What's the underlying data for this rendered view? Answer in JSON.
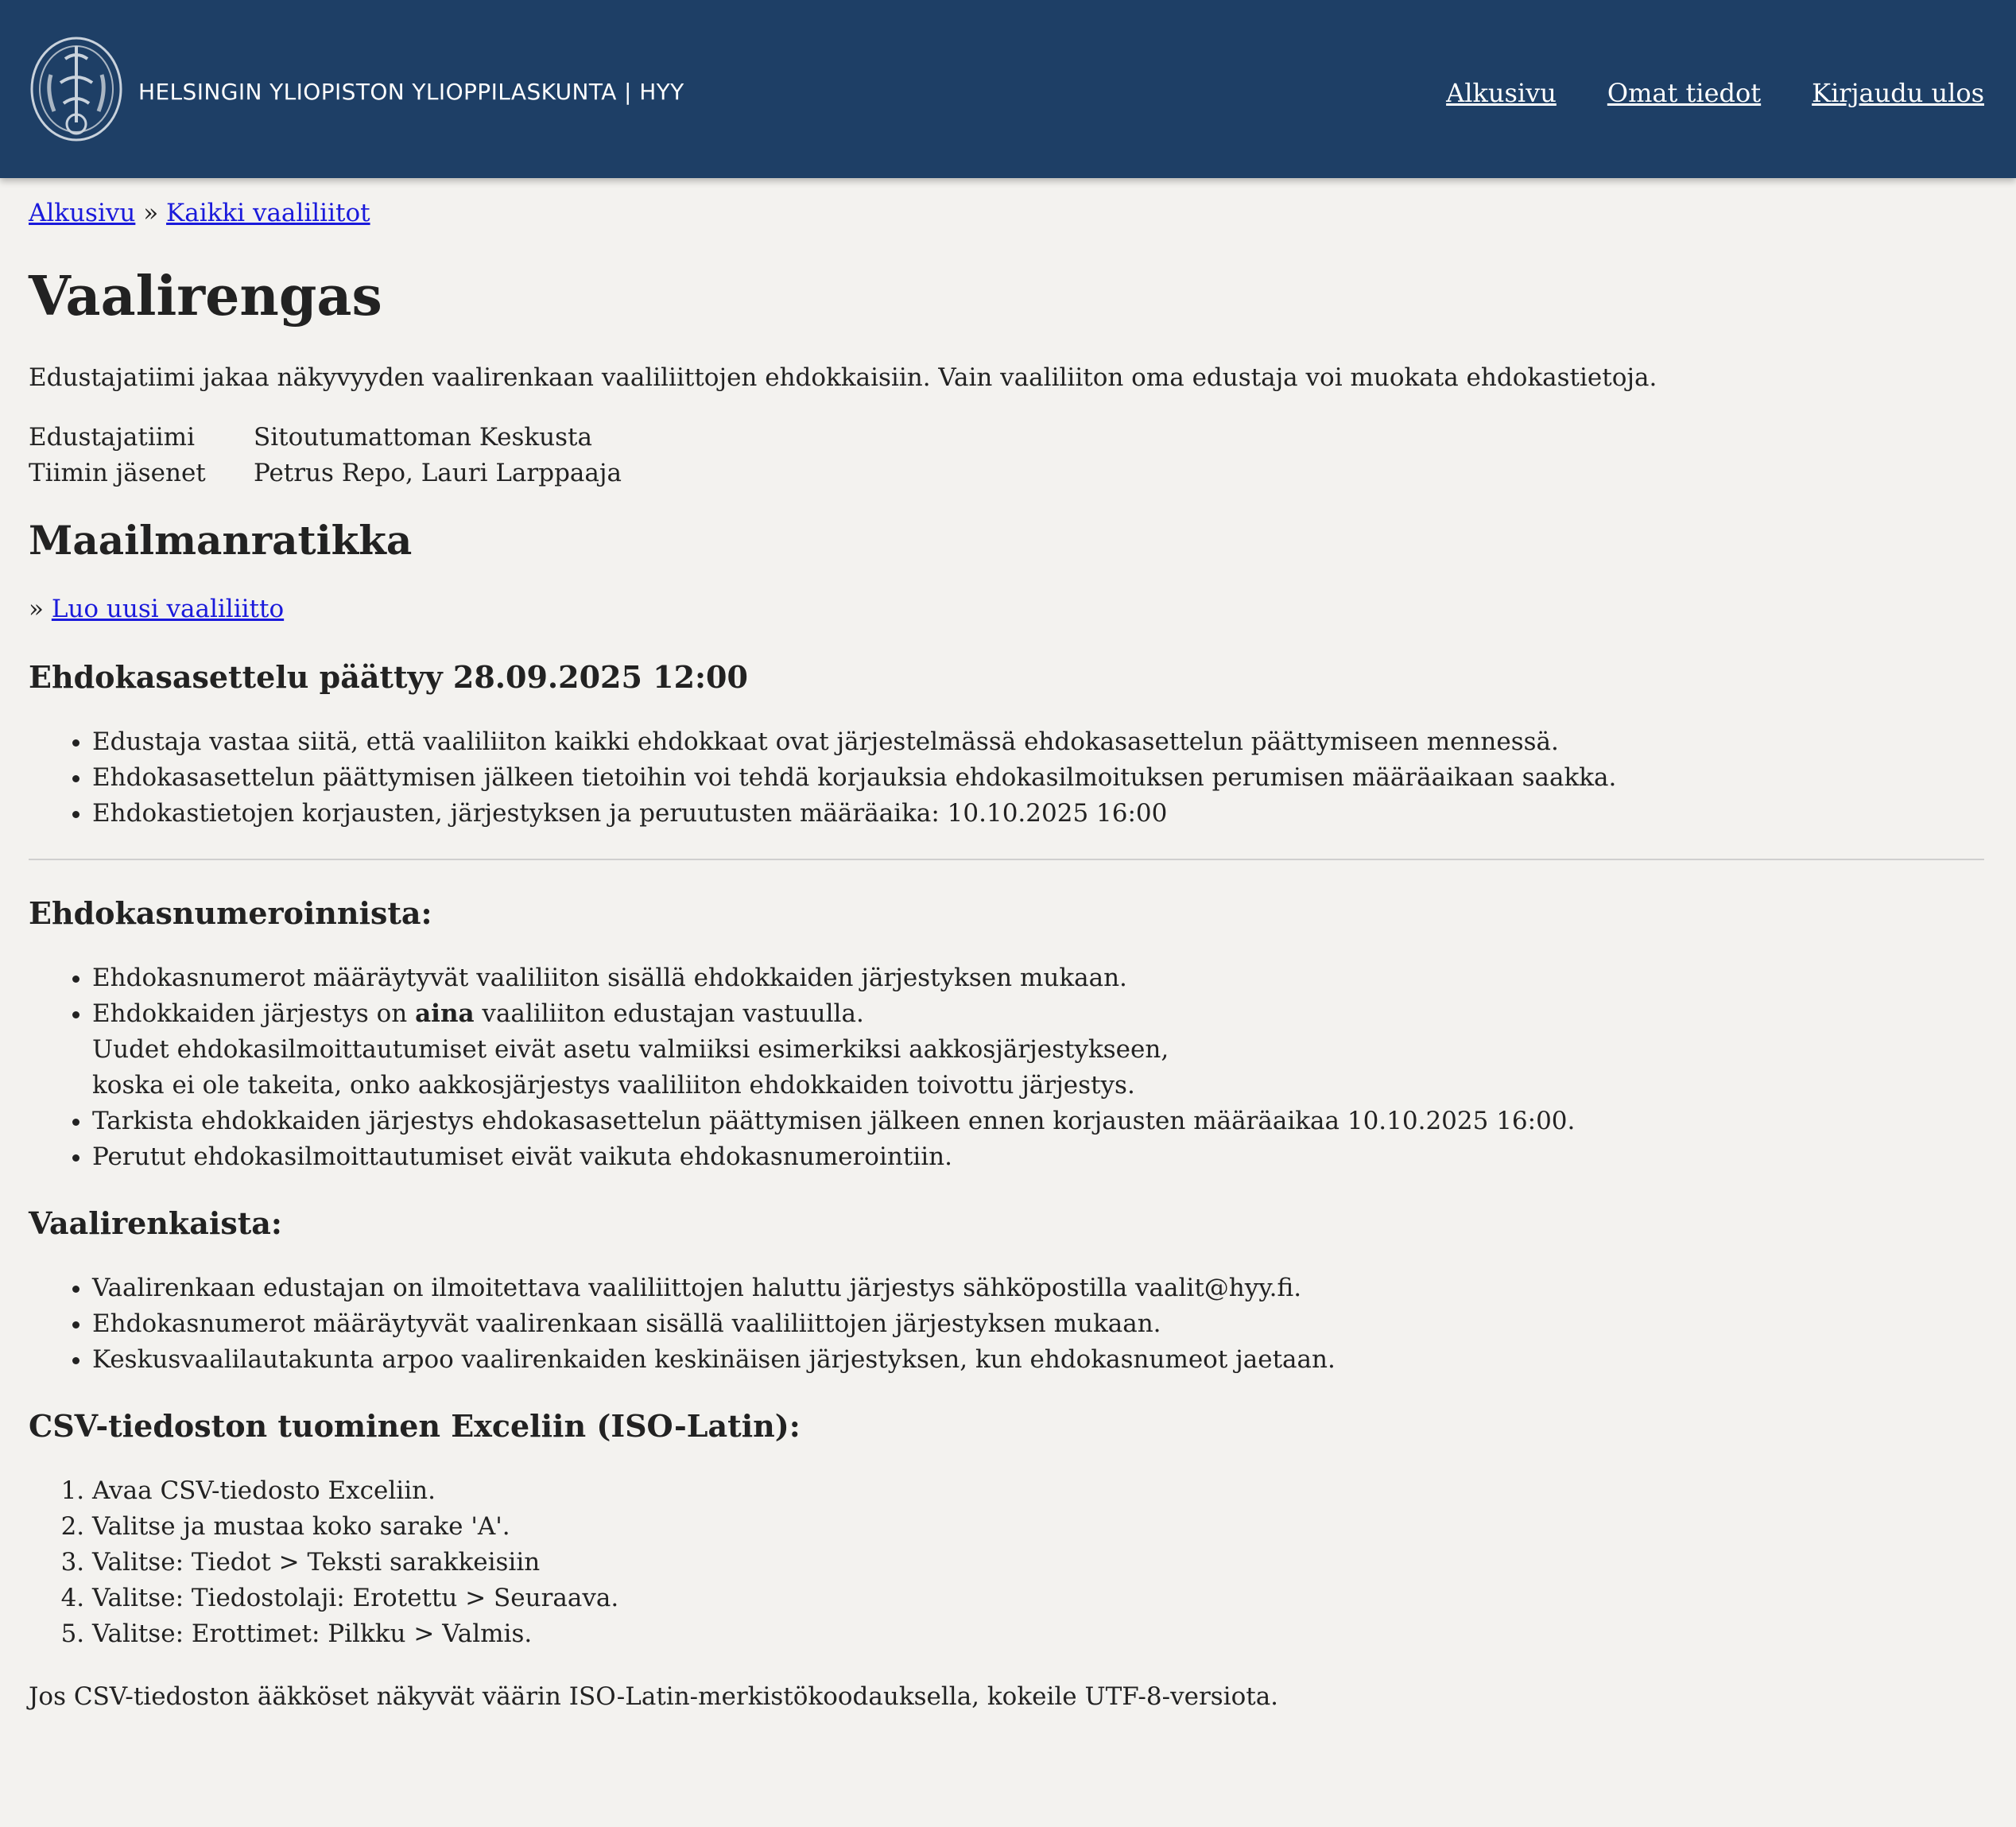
{
  "header": {
    "org_name": "HELSINGIN YLIOPISTON YLIOPPILASKUNTA | HYY",
    "nav": [
      "Alkusivu",
      "Omat tiedot",
      "Kirjaudu ulos"
    ],
    "background_color": "#1e3f66"
  },
  "breadcrumb": {
    "home": "Alkusivu",
    "separator": "»",
    "current": "Kaikki vaaliliitot"
  },
  "page": {
    "title": "Vaalirengas",
    "description": "Edustajatiimi jakaa näkyvyyden vaalirenkaan vaaliliittojen ehdokkaisiin. Vain vaaliliiton oma edustaja voi muokata ehdokastietoja.",
    "info": [
      {
        "label": "Edustajatiimi",
        "value": "Sitoutumattoman Keskusta"
      },
      {
        "label": "Tiimin jäsenet",
        "value": "Petrus Repo, Lauri Larppaaja"
      }
    ],
    "ring_name": "Maailmanratikka",
    "new_link_prefix": "»",
    "new_link": "Luo uusi vaaliliitto"
  },
  "deadline": {
    "heading": "Ehdokasasettelu päättyy 28.09.2025 12:00",
    "items": [
      "Edustaja vastaa siitä, että vaaliliiton kaikki ehdokkaat ovat järjestelmässä ehdokasasettelun päättymiseen mennessä.",
      "Ehdokasasettelun päättymisen jälkeen tietoihin voi tehdä korjauksia ehdokasilmoituksen perumisen määräaikaan saakka.",
      "Ehdokastietojen korjausten, järjestyksen ja peruutusten määräaika: 10.10.2025 16:00"
    ]
  },
  "numbering": {
    "heading": "Ehdokasnumeroinnista:",
    "item1": "Ehdokasnumerot määräytyvät vaaliliiton sisällä ehdokkaiden järjestyksen mukaan.",
    "item2_pre": "Ehdokkaiden järjestys on ",
    "item2_bold": "aina",
    "item2_post": " vaaliliiton edustajan vastuulla.",
    "item2_line2": "Uudet ehdokasilmoittautumiset eivät asetu valmiiksi esimerkiksi aakkosjärjestykseen,",
    "item2_line3": "koska ei ole takeita, onko aakkosjärjestys vaaliliiton ehdokkaiden toivottu järjestys.",
    "item3": "Tarkista ehdokkaiden järjestys ehdokasasettelun päättymisen jälkeen ennen korjausten määräaikaa 10.10.2025 16:00.",
    "item4": "Perutut ehdokasilmoittautumiset eivät vaikuta ehdokasnumerointiin."
  },
  "rings": {
    "heading": "Vaalirenkaista:",
    "items": [
      "Vaalirenkaan edustajan on ilmoitettava vaaliliittojen haluttu järjestys sähköpostilla vaalit@hyy.fi.",
      "Ehdokasnumerot määräytyvät vaalirenkaan sisällä vaaliliittojen järjestyksen mukaan.",
      "Keskusvaalilautakunta arpoo vaalirenkaiden keskinäisen järjestyksen, kun ehdokasnumeot jaetaan."
    ]
  },
  "csv": {
    "heading": "CSV-tiedoston tuominen Exceliin (ISO-Latin):",
    "steps": [
      "Avaa CSV-tiedosto Exceliin.",
      "Valitse ja mustaa koko sarake 'A'.",
      "Valitse: Tiedot > Teksti sarakkeisiin",
      "Valitse: Tiedostolaji: Erotettu > Seuraava.",
      "Valitse: Erottimet: Pilkku > Valmis."
    ],
    "note": "Jos CSV-tiedoston ääkköset näkyvät väärin ISO-Latin-merkistökoodauksella, kokeile UTF-8-versiota."
  }
}
